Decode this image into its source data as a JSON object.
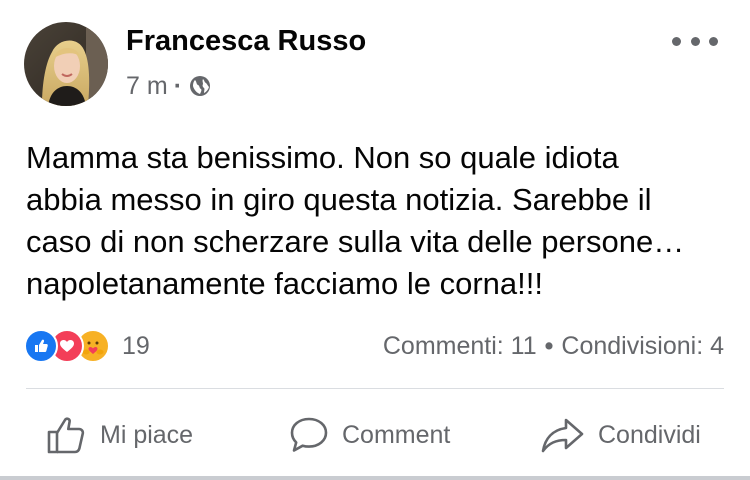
{
  "post": {
    "author": "Francesca Russo",
    "time": "7 m",
    "separator": "·",
    "privacy_icon": "globe-icon",
    "more_icon": "more-horizontal-icon",
    "text_lines": [
      "Mamma sta benissimo. Non so quale idiota",
      "abbia messo in giro questa notizia. Sarebbe il",
      "caso di non scherzare sulla vita delle persone…",
      "napoletanamente facciamo le corna!!!"
    ]
  },
  "reactions": {
    "icons": [
      "like-icon",
      "love-icon",
      "care-icon"
    ],
    "count": "19"
  },
  "stats": {
    "comments": "Commenti: 11",
    "separator": "•",
    "shares": "Condivisioni: 4"
  },
  "actions": {
    "like": "Mi piace",
    "comment": "Comment",
    "share": "Condividi"
  },
  "colors": {
    "like_blue": "#1877f2",
    "love_red": "#f33e58",
    "care_yellow": "#f7b125",
    "secondary_text": "#65676b"
  }
}
